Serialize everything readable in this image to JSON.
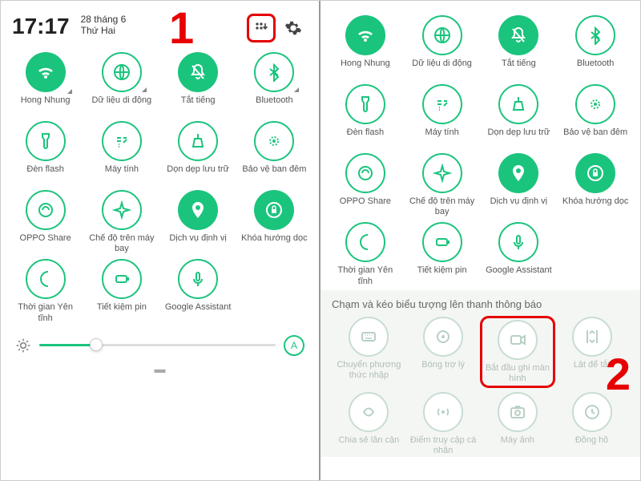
{
  "colors": {
    "accent": "#1bc47d",
    "alert": "#e60000"
  },
  "callouts": {
    "one": "1",
    "two": "2"
  },
  "left": {
    "time": "17:17",
    "date_line1": "28 tháng 6",
    "date_line2": "Thứ Hai",
    "tiles": [
      {
        "label": "Hong Nhung",
        "icon": "wifi",
        "state": "on",
        "expand": true
      },
      {
        "label": "Dữ liệu di động",
        "icon": "globe",
        "state": "off",
        "expand": true
      },
      {
        "label": "Tắt tiếng",
        "icon": "bell-off",
        "state": "on",
        "expand": false
      },
      {
        "label": "Bluetooth",
        "icon": "bluetooth",
        "state": "off",
        "expand": true
      },
      {
        "label": "Đèn flash",
        "icon": "flashlight",
        "state": "off",
        "expand": false
      },
      {
        "label": "Máy tính",
        "icon": "calculator",
        "state": "off",
        "expand": false
      },
      {
        "label": "Dọn dẹp lưu trữ",
        "icon": "cleanup",
        "state": "off",
        "expand": false
      },
      {
        "label": "Bảo vệ ban đêm",
        "icon": "night",
        "state": "off",
        "expand": false
      },
      {
        "label": "OPPO Share",
        "icon": "share",
        "state": "off",
        "expand": false
      },
      {
        "label": "Chế độ trên máy bay",
        "icon": "airplane",
        "state": "off",
        "expand": false
      },
      {
        "label": "Dịch vụ định vị",
        "icon": "location",
        "state": "on",
        "expand": false
      },
      {
        "label": "Khóa hướng dọc",
        "icon": "lock-rotation",
        "state": "on",
        "expand": false
      },
      {
        "label": "Thời gian Yên tĩnh",
        "icon": "moon",
        "state": "off",
        "expand": false
      },
      {
        "label": "Tiết kiệm pin",
        "icon": "battery",
        "state": "off",
        "expand": false
      },
      {
        "label": "Google Assistant",
        "icon": "mic",
        "state": "off",
        "expand": false
      }
    ],
    "brightness_pct": 24,
    "auto_label": "A"
  },
  "right": {
    "tiles_main": [
      {
        "label": "Hong Nhung",
        "icon": "wifi",
        "state": "on"
      },
      {
        "label": "Dữ liệu di động",
        "icon": "globe",
        "state": "off"
      },
      {
        "label": "Tắt tiếng",
        "icon": "bell-off",
        "state": "on"
      },
      {
        "label": "Bluetooth",
        "icon": "bluetooth",
        "state": "off"
      },
      {
        "label": "Đèn flash",
        "icon": "flashlight",
        "state": "off"
      },
      {
        "label": "Máy tính",
        "icon": "calculator",
        "state": "off"
      },
      {
        "label": "Dọn dẹp lưu trữ",
        "icon": "cleanup",
        "state": "off"
      },
      {
        "label": "Bảo vệ ban đêm",
        "icon": "night",
        "state": "off"
      },
      {
        "label": "OPPO Share",
        "icon": "share",
        "state": "off"
      },
      {
        "label": "Chế độ trên máy bay",
        "icon": "airplane",
        "state": "off"
      },
      {
        "label": "Dịch vụ định vị",
        "icon": "location",
        "state": "on"
      },
      {
        "label": "Khóa hướng dọc",
        "icon": "lock-rotation",
        "state": "on"
      },
      {
        "label": "Thời gian Yên tĩnh",
        "icon": "moon",
        "state": "off"
      },
      {
        "label": "Tiết kiệm pin",
        "icon": "battery",
        "state": "off"
      },
      {
        "label": "Google Assistant",
        "icon": "mic",
        "state": "off"
      }
    ],
    "section_title": "Chạm và kéo biểu tượng lên thanh thông báo",
    "tiles_tray": [
      {
        "label": "Chuyển phương thức nhập",
        "icon": "keyboard"
      },
      {
        "label": "Bóng trợ lý",
        "icon": "ball"
      },
      {
        "label": "Bắt đầu ghi màn hình",
        "icon": "record",
        "highlight": true
      },
      {
        "label": "Lật để tắt",
        "icon": "flip"
      },
      {
        "label": "Chia sẻ lân cận",
        "icon": "nearby"
      },
      {
        "label": "Điểm truy cập cá nhân",
        "icon": "hotspot"
      },
      {
        "label": "Máy ảnh",
        "icon": "camera"
      },
      {
        "label": "Đồng hồ",
        "icon": "clock"
      }
    ]
  }
}
